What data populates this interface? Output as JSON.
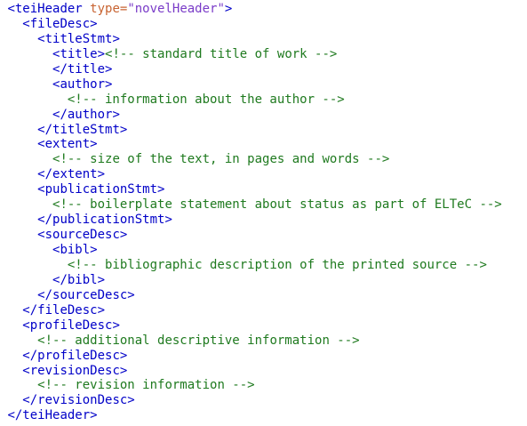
{
  "colors": {
    "tag": "#0000c8",
    "attribute_name": "#c86432",
    "attribute_value": "#7a3cc8",
    "comment": "#1f7a1f",
    "background": "#ffffff"
  },
  "lines": [
    {
      "indent": " ",
      "parts": [
        {
          "kind": "tag",
          "text": "<teiHeader "
        },
        {
          "kind": "attr-name",
          "text": "type="
        },
        {
          "kind": "attr-value",
          "text": "\"novelHeader\""
        },
        {
          "kind": "tag",
          "text": ">"
        }
      ]
    },
    {
      "indent": "   ",
      "parts": [
        {
          "kind": "tag",
          "text": "<fileDesc>"
        }
      ]
    },
    {
      "indent": "     ",
      "parts": [
        {
          "kind": "tag",
          "text": "<titleStmt>"
        }
      ]
    },
    {
      "indent": "       ",
      "parts": [
        {
          "kind": "tag",
          "text": "<title>"
        },
        {
          "kind": "comment",
          "text": "<!-- standard title of work -->"
        }
      ]
    },
    {
      "indent": "       ",
      "parts": [
        {
          "kind": "tag",
          "text": "</title>"
        }
      ]
    },
    {
      "indent": "       ",
      "parts": [
        {
          "kind": "tag",
          "text": "<author>"
        }
      ]
    },
    {
      "indent": "         ",
      "parts": [
        {
          "kind": "comment",
          "text": "<!-- information about the author -->"
        }
      ]
    },
    {
      "indent": "       ",
      "parts": [
        {
          "kind": "tag",
          "text": "</author>"
        }
      ]
    },
    {
      "indent": "     ",
      "parts": [
        {
          "kind": "tag",
          "text": "</titleStmt>"
        }
      ]
    },
    {
      "indent": "     ",
      "parts": [
        {
          "kind": "tag",
          "text": "<extent>"
        }
      ]
    },
    {
      "indent": "       ",
      "parts": [
        {
          "kind": "comment",
          "text": "<!-- size of the text, in pages and words -->"
        }
      ]
    },
    {
      "indent": "     ",
      "parts": [
        {
          "kind": "tag",
          "text": "</extent>"
        }
      ]
    },
    {
      "indent": "     ",
      "parts": [
        {
          "kind": "tag",
          "text": "<publicationStmt>"
        }
      ]
    },
    {
      "indent": "       ",
      "parts": [
        {
          "kind": "comment",
          "text": "<!-- boilerplate statement about status as part of ELTeC -->"
        }
      ]
    },
    {
      "indent": "     ",
      "parts": [
        {
          "kind": "tag",
          "text": "</publicationStmt>"
        }
      ]
    },
    {
      "indent": "     ",
      "parts": [
        {
          "kind": "tag",
          "text": "<sourceDesc>"
        }
      ]
    },
    {
      "indent": "       ",
      "parts": [
        {
          "kind": "tag",
          "text": "<bibl>"
        }
      ]
    },
    {
      "indent": "         ",
      "parts": [
        {
          "kind": "comment",
          "text": "<!-- bibliographic description of the printed source -->"
        }
      ]
    },
    {
      "indent": "       ",
      "parts": [
        {
          "kind": "tag",
          "text": "</bibl>"
        }
      ]
    },
    {
      "indent": "     ",
      "parts": [
        {
          "kind": "tag",
          "text": "</sourceDesc>"
        }
      ]
    },
    {
      "indent": "   ",
      "parts": [
        {
          "kind": "tag",
          "text": "</fileDesc>"
        }
      ]
    },
    {
      "indent": "   ",
      "parts": [
        {
          "kind": "tag",
          "text": "<profileDesc>"
        }
      ]
    },
    {
      "indent": "     ",
      "parts": [
        {
          "kind": "comment",
          "text": "<!-- additional descriptive information -->"
        }
      ]
    },
    {
      "indent": "   ",
      "parts": [
        {
          "kind": "tag",
          "text": "</profileDesc>"
        }
      ]
    },
    {
      "indent": "   ",
      "parts": [
        {
          "kind": "tag",
          "text": "<revisionDesc>"
        }
      ]
    },
    {
      "indent": "     ",
      "parts": [
        {
          "kind": "comment",
          "text": "<!-- revision information -->"
        }
      ]
    },
    {
      "indent": "   ",
      "parts": [
        {
          "kind": "tag",
          "text": "</revisionDesc>"
        }
      ]
    },
    {
      "indent": " ",
      "parts": [
        {
          "kind": "tag",
          "text": "</teiHeader>"
        }
      ]
    }
  ]
}
